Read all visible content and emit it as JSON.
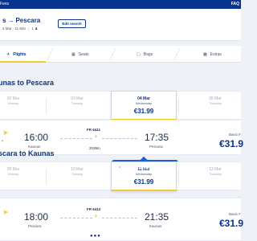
{
  "topbar": {
    "left_text": "Fees",
    "right_text": "FAQ"
  },
  "trip": {
    "from_partial": "s",
    "arrow": "→",
    "to": "Pescara",
    "dates": "4 Mar - 11 Mar",
    "passengers": "1",
    "edit_label": "Edit search"
  },
  "steps": [
    {
      "label": "Flights",
      "icon": "plane-icon"
    },
    {
      "label": "Seats",
      "icon": "seat-icon"
    },
    {
      "label": "Bags",
      "icon": "bag-icon"
    },
    {
      "label": "Extras",
      "icon": "extras-icon"
    }
  ],
  "outbound": {
    "title": "unas to Pescara",
    "dates": [
      {
        "date": "02 Mar",
        "weekday": "Monday",
        "price": ""
      },
      {
        "date": "03 Mar",
        "weekday": "Tuesday",
        "price": ""
      },
      {
        "date": "04 Mar",
        "weekday": "Wednesday",
        "price": "€31.99"
      },
      {
        "date": "05 Mar",
        "weekday": "Thursday",
        "price": ""
      }
    ],
    "flight": {
      "logo_sub": "c",
      "depart_time": "16:00",
      "depart_city": "Kaunas",
      "flight_no": "FR 6411",
      "duration": "2h35m",
      "arrive_time": "17:35",
      "arrive_city": "Pescara",
      "fare_label": "Basic F",
      "price": "€31.9"
    }
  },
  "tooltip": {
    "text": "Choose a flight to continue",
    "icon": "i"
  },
  "inbound": {
    "title": "scara to Kaunas",
    "dates": [
      {
        "date": "09 Mar",
        "weekday": "Monday",
        "price": ""
      },
      {
        "date": "10 Mar",
        "weekday": "Tuesday",
        "price": ""
      },
      {
        "date": "11 Mar",
        "weekday": "Wednesday",
        "price": "€31.99"
      },
      {
        "date": "12 Mar",
        "weekday": "Thursday",
        "price": ""
      }
    ],
    "flight": {
      "depart_time": "18:00",
      "depart_city": "Pescara",
      "flight_no": "FR 6412",
      "arrive_time": "21:35",
      "arrive_city": "Kaunas",
      "fare_label": "Basic F",
      "price": "€31.9"
    }
  },
  "colors": {
    "brand": "#073590",
    "accent": "#f1c933",
    "tooltip": "#1e60d1"
  }
}
